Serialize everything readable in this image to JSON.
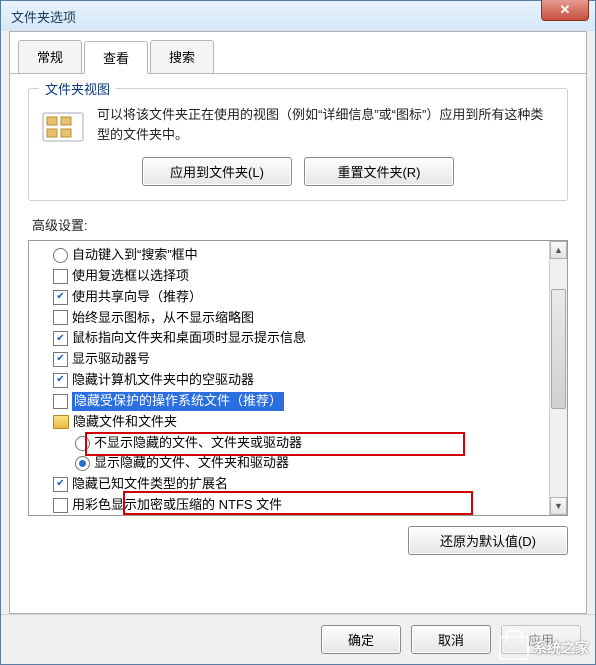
{
  "window": {
    "title": "文件夹选项"
  },
  "tabs": {
    "general": "常规",
    "view": "查看",
    "search": "搜索"
  },
  "folderView": {
    "groupTitle": "文件夹视图",
    "desc": "可以将该文件夹正在使用的视图（例如“详细信息”或“图标”）应用到所有这种类型的文件夹中。",
    "applyBtn": "应用到文件夹(L)",
    "resetBtn": "重置文件夹(R)"
  },
  "advanced": {
    "label": "高级设置:",
    "items": [
      {
        "ctrl": "radio",
        "checked": false,
        "indent": 1,
        "text": "自动键入到“搜索”框中"
      },
      {
        "ctrl": "checkbox",
        "checked": false,
        "indent": 1,
        "text": "使用复选框以选择项"
      },
      {
        "ctrl": "checkbox",
        "checked": true,
        "indent": 1,
        "text": "使用共享向导（推荐）"
      },
      {
        "ctrl": "checkbox",
        "checked": false,
        "indent": 1,
        "text": "始终显示图标，从不显示缩略图"
      },
      {
        "ctrl": "checkbox",
        "checked": true,
        "indent": 1,
        "text": "鼠标指向文件夹和桌面项时显示提示信息"
      },
      {
        "ctrl": "checkbox",
        "checked": true,
        "indent": 1,
        "text": "显示驱动器号"
      },
      {
        "ctrl": "checkbox",
        "checked": true,
        "indent": 1,
        "text": "隐藏计算机文件夹中的空驱动器"
      },
      {
        "ctrl": "checkbox",
        "checked": false,
        "indent": 1,
        "text": "隐藏受保护的操作系统文件（推荐）",
        "highlight": true
      },
      {
        "ctrl": "folder",
        "indent": 1,
        "text": "隐藏文件和文件夹"
      },
      {
        "ctrl": "radio",
        "checked": false,
        "indent": 2,
        "text": "不显示隐藏的文件、文件夹或驱动器"
      },
      {
        "ctrl": "radio",
        "checked": true,
        "indent": 2,
        "text": "显示隐藏的文件、文件夹和驱动器"
      },
      {
        "ctrl": "checkbox",
        "checked": true,
        "indent": 1,
        "text": "隐藏已知文件类型的扩展名"
      },
      {
        "ctrl": "checkbox",
        "checked": false,
        "indent": 1,
        "text": "用彩色显示加密或压缩的 NTFS 文件"
      }
    ],
    "restoreBtn": "还原为默认值(D)"
  },
  "footer": {
    "ok": "确定",
    "cancel": "取消",
    "apply": "应用"
  },
  "watermark": "系统之家"
}
